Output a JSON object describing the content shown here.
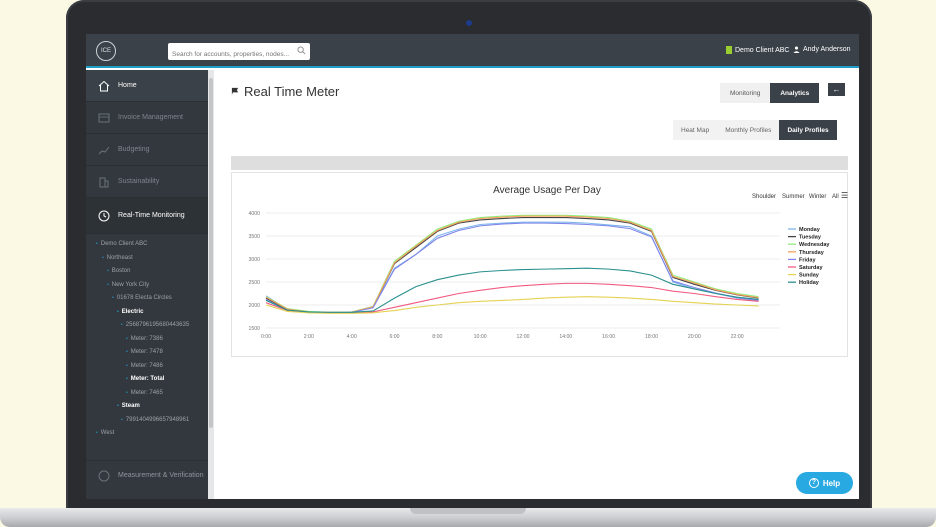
{
  "header": {
    "logo_text": "ICE",
    "search_placeholder": "Search for accounts, properties, nodes...",
    "client": "Demo Client ABC",
    "user": "Andy Anderson"
  },
  "sidebar": {
    "items": [
      {
        "label": "Home",
        "icon": "home-icon"
      },
      {
        "label": "Invoice Management",
        "icon": "invoice-icon"
      },
      {
        "label": "Budgeting",
        "icon": "budget-chart-icon"
      },
      {
        "label": "Sustainability",
        "icon": "building-icon"
      },
      {
        "label": "Real-Time Monitoring",
        "icon": "clock-icon"
      }
    ],
    "tree": [
      {
        "label": "Demo Client ABC",
        "indent": 0,
        "bold": false
      },
      {
        "label": "Northeast",
        "indent": 1,
        "bold": false
      },
      {
        "label": "Boston",
        "indent": 2,
        "bold": false
      },
      {
        "label": "New York City",
        "indent": 2,
        "bold": false
      },
      {
        "label": "01678 Electa Circles",
        "indent": 3,
        "bold": false
      },
      {
        "label": "Electric",
        "indent": 4,
        "bold": true
      },
      {
        "label": "2568796195680443635",
        "indent": 5,
        "bold": false
      },
      {
        "label": "Meter: 7386",
        "indent": 6,
        "bold": false
      },
      {
        "label": "Meter: 7478",
        "indent": 6,
        "bold": false
      },
      {
        "label": "Meter: 7486",
        "indent": 6,
        "bold": false
      },
      {
        "label": "Meter: Total",
        "indent": 6,
        "bold": true
      },
      {
        "label": "Meter: 7465",
        "indent": 6,
        "bold": false
      },
      {
        "label": "Steam",
        "indent": 4,
        "bold": true
      },
      {
        "label": "7991404996657948961",
        "indent": 5,
        "bold": false
      },
      {
        "label": "West",
        "indent": 0,
        "bold": false
      }
    ],
    "bottom_item": "Measurement & Verification"
  },
  "main": {
    "title": "Real Time Meter",
    "tabs": [
      "Monitoring",
      "Analytics"
    ],
    "active_tab": "Analytics",
    "back_icon": "←",
    "subtabs": [
      "Heat Map",
      "Monthly Profiles",
      "Daily Profiles"
    ],
    "active_subtab": "Daily Profiles",
    "season_filters": [
      "Shoulder",
      "Summer",
      "Winter",
      "All"
    ],
    "menu_icon": "☰"
  },
  "help_label": "Help",
  "chart_data": {
    "type": "line",
    "title": "Average Usage Per Day",
    "xlabel": "",
    "ylabel": "",
    "ylim": [
      1500,
      4000
    ],
    "y_ticks": [
      "1500",
      "2000",
      "2500",
      "3000",
      "3500",
      "4000"
    ],
    "x_tick_labels": [
      "0:00",
      "2:00",
      "4:00",
      "6:00",
      "8:00",
      "10:00",
      "12:00",
      "14:00",
      "16:00",
      "18:00",
      "20:00",
      "22:00"
    ],
    "x": [
      "0:00",
      "1:00",
      "2:00",
      "3:00",
      "4:00",
      "5:00",
      "6:00",
      "7:00",
      "8:00",
      "9:00",
      "10:00",
      "11:00",
      "12:00",
      "13:00",
      "14:00",
      "15:00",
      "16:00",
      "17:00",
      "18:00",
      "19:00",
      "20:00",
      "21:00",
      "22:00",
      "23:00"
    ],
    "legend_position": "right",
    "grid": true,
    "series": [
      {
        "name": "Monday",
        "color": "#7cb5ec",
        "values": [
          2200,
          1900,
          1850,
          1840,
          1850,
          1950,
          2800,
          3100,
          3500,
          3650,
          3750,
          3780,
          3800,
          3800,
          3800,
          3780,
          3740,
          3700,
          3500,
          2500,
          2350,
          2250,
          2150,
          2100
        ]
      },
      {
        "name": "Tuesday",
        "color": "#434348",
        "values": [
          2150,
          1900,
          1850,
          1830,
          1840,
          1960,
          2900,
          3250,
          3600,
          3780,
          3850,
          3880,
          3900,
          3900,
          3900,
          3880,
          3850,
          3780,
          3600,
          2600,
          2450,
          2320,
          2220,
          2150
        ]
      },
      {
        "name": "Wednesday",
        "color": "#90ed7d",
        "values": [
          2180,
          1920,
          1860,
          1840,
          1850,
          1970,
          2950,
          3300,
          3650,
          3820,
          3900,
          3930,
          3950,
          3950,
          3950,
          3930,
          3900,
          3820,
          3650,
          2650,
          2500,
          2350,
          2250,
          2180
        ]
      },
      {
        "name": "Thursday",
        "color": "#f7a35c",
        "values": [
          2170,
          1910,
          1850,
          1840,
          1845,
          1960,
          2920,
          3280,
          3620,
          3800,
          3880,
          3910,
          3930,
          3930,
          3930,
          3910,
          3880,
          3800,
          3620,
          2620,
          2480,
          2330,
          2230,
          2160
        ]
      },
      {
        "name": "Friday",
        "color": "#8085e9",
        "values": [
          2120,
          1880,
          1840,
          1830,
          1840,
          1940,
          2780,
          3100,
          3450,
          3620,
          3720,
          3760,
          3780,
          3780,
          3770,
          3750,
          3720,
          3660,
          3480,
          2520,
          2380,
          2260,
          2160,
          2100
        ]
      },
      {
        "name": "Saturday",
        "color": "#f15c80",
        "values": [
          2050,
          1880,
          1840,
          1830,
          1830,
          1850,
          1950,
          2050,
          2150,
          2250,
          2320,
          2380,
          2420,
          2450,
          2470,
          2470,
          2450,
          2420,
          2380,
          2300,
          2250,
          2180,
          2120,
          2080
        ]
      },
      {
        "name": "Sunday",
        "color": "#e4d354",
        "values": [
          2000,
          1860,
          1830,
          1820,
          1820,
          1830,
          1880,
          1950,
          2000,
          2050,
          2080,
          2100,
          2120,
          2150,
          2170,
          2180,
          2170,
          2150,
          2120,
          2080,
          2050,
          2020,
          2000,
          1980
        ]
      },
      {
        "name": "Holiday",
        "color": "#2b908f",
        "values": [
          2100,
          1890,
          1850,
          1840,
          1840,
          1870,
          2150,
          2400,
          2550,
          2650,
          2720,
          2750,
          2770,
          2780,
          2790,
          2800,
          2780,
          2740,
          2650,
          2450,
          2350,
          2250,
          2170,
          2120
        ]
      }
    ]
  }
}
